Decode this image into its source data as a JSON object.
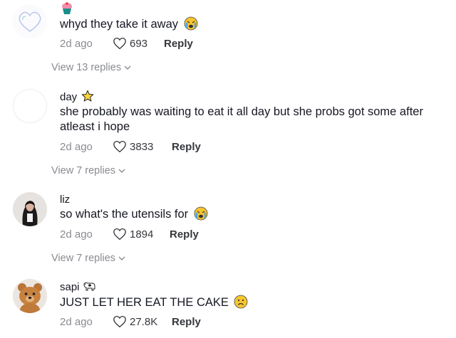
{
  "comments": [
    {
      "username": "",
      "text": "whyd they take it away",
      "time": "2d ago",
      "likes": "693",
      "reply_label": "Reply",
      "emoji": "crying-face-icon"
    },
    {
      "username": "day",
      "text": "she probably was waiting to eat it all day but she probs got some after atleast i hope",
      "time": "2d ago",
      "likes": "3833",
      "reply_label": "Reply",
      "badge": "star-icon"
    },
    {
      "username": "liz",
      "text": "so what's the utensils for",
      "time": "2d ago",
      "likes": "1894",
      "reply_label": "Reply",
      "emoji": "crying-face-icon"
    },
    {
      "username": "sapi",
      "text": "JUST LET HER EAT THE CAKE",
      "time": "2d ago",
      "likes": "27.8K",
      "reply_label": "Reply",
      "badge": "cow-icon",
      "emoji": "sad-face-icon"
    }
  ],
  "replies_toggles": [
    {
      "label": "View 13 replies"
    },
    {
      "label": "View 7 replies"
    },
    {
      "label": "View 7 replies"
    }
  ],
  "colors": {
    "text": "#161823",
    "secondary": "#8a8b91",
    "meta_dark": "#36373d"
  }
}
